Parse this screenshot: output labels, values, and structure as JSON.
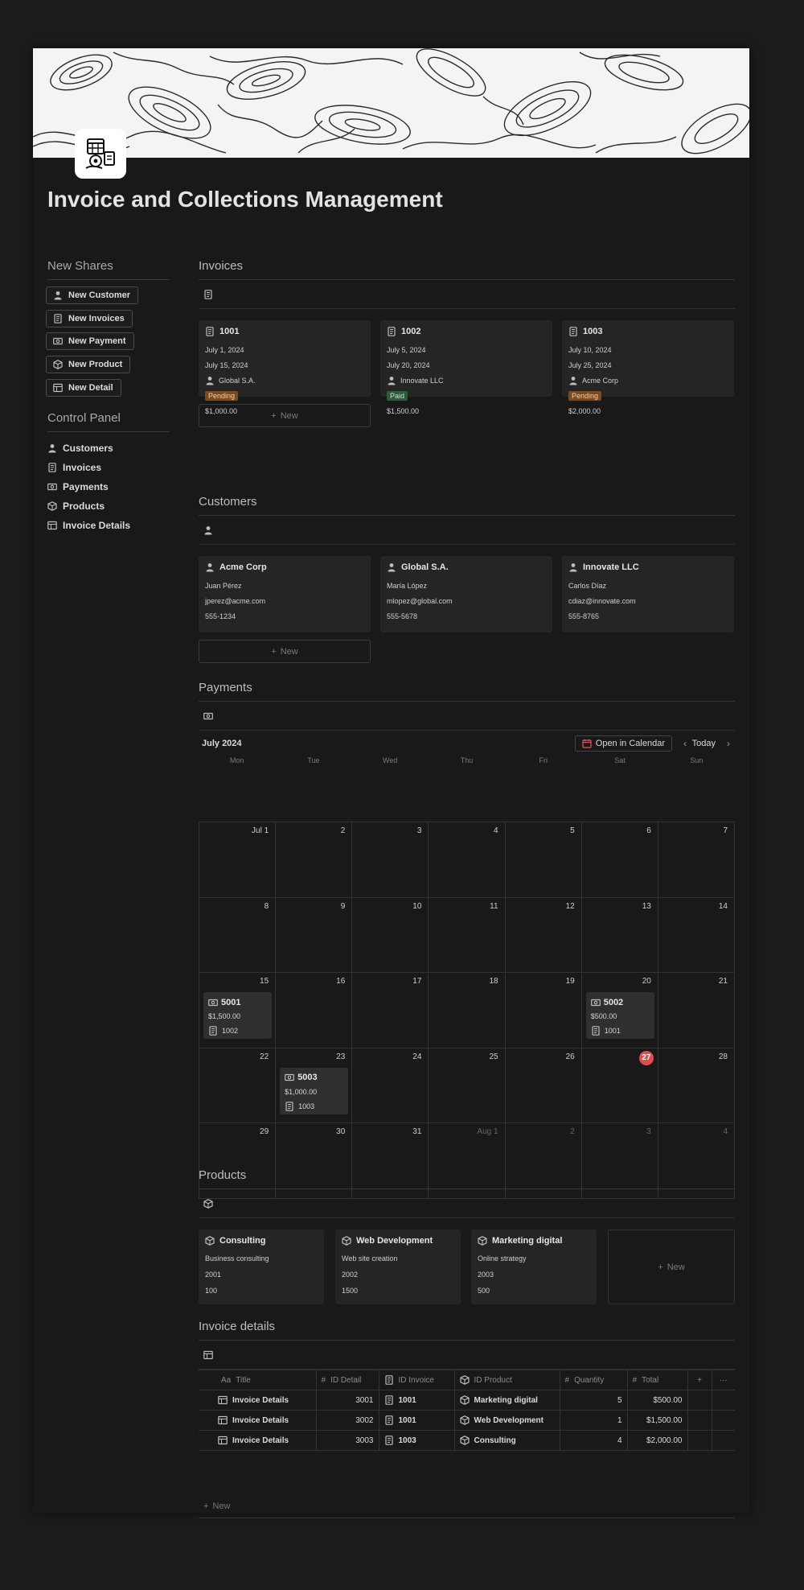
{
  "page": {
    "title": "Invoice and Collections Management"
  },
  "sidebar": {
    "new_shares_heading": "New Shares",
    "buttons": [
      {
        "label": "New Customer",
        "icon": "person-icon"
      },
      {
        "label": "New Invoices",
        "icon": "receipt-icon"
      },
      {
        "label": "New Payment",
        "icon": "money-icon"
      },
      {
        "label": "New Product",
        "icon": "box-icon"
      },
      {
        "label": "New Detail",
        "icon": "table-icon"
      }
    ],
    "control_panel_heading": "Control Panel",
    "links": [
      {
        "label": "Customers",
        "icon": "person-icon"
      },
      {
        "label": "Invoices",
        "icon": "receipt-icon"
      },
      {
        "label": "Payments",
        "icon": "money-icon"
      },
      {
        "label": "Products",
        "icon": "box-icon"
      },
      {
        "label": "Invoice Details",
        "icon": "table-icon"
      }
    ]
  },
  "invoices": {
    "title": "Invoices",
    "new_label": "New",
    "cards": [
      {
        "id": "1001",
        "date1": "July 1, 2024",
        "date2": "July 15, 2024",
        "customer": "Global S.A.",
        "status": "Pending",
        "amount": "$1,000.00"
      },
      {
        "id": "1002",
        "date1": "July 5, 2024",
        "date2": "July 20, 2024",
        "customer": "Innovate LLC",
        "status": "Paid",
        "amount": "$1,500.00"
      },
      {
        "id": "1003",
        "date1": "July 10, 2024",
        "date2": "July 25, 2024",
        "customer": "Acme Corp",
        "status": "Pending",
        "amount": "$2,000.00"
      }
    ],
    "status_colors": {
      "Pending": "#7c4a1c",
      "Paid": "#2c5a3a"
    }
  },
  "customers": {
    "title": "Customers",
    "new_label": "New",
    "cards": [
      {
        "name": "Acme Corp",
        "contact": "Juan Pérez",
        "email": "jperez@acme.com",
        "phone": "555-1234"
      },
      {
        "name": "Global S.A.",
        "contact": "María López",
        "email": "mlopez@global.com",
        "phone": "555-5678"
      },
      {
        "name": "Innovate LLC",
        "contact": "Carlos Díaz",
        "email": "cdiaz@innovate.com",
        "phone": "555-8765"
      }
    ]
  },
  "payments": {
    "title": "Payments",
    "month": "July 2024",
    "open_in_calendar": "Open in Calendar",
    "today": "Today",
    "weekdays": [
      "Mon",
      "Tue",
      "Wed",
      "Thu",
      "Fri",
      "Sat",
      "Sun"
    ],
    "days": [
      "Jul 1",
      "2",
      "3",
      "4",
      "5",
      "6",
      "7",
      "8",
      "9",
      "10",
      "11",
      "12",
      "13",
      "14",
      "15",
      "16",
      "17",
      "18",
      "19",
      "20",
      "21",
      "22",
      "23",
      "24",
      "25",
      "26",
      "27",
      "28",
      "29",
      "30",
      "31",
      "Aug 1",
      "2",
      "3",
      "4"
    ],
    "today_index": 26,
    "today_color": "#e34c4c",
    "events": [
      {
        "day_index": 14,
        "id": "5001",
        "amount": "$1,500.00",
        "invoice": "1002"
      },
      {
        "day_index": 19,
        "id": "5002",
        "amount": "$500.00",
        "invoice": "1001"
      },
      {
        "day_index": 22,
        "id": "5003",
        "amount": "$1,000.00",
        "invoice": "1003"
      }
    ]
  },
  "products": {
    "title": "Products",
    "new_label": "New",
    "cards": [
      {
        "name": "Consulting",
        "description": "Business consulting",
        "code": "2001",
        "price": "100"
      },
      {
        "name": "Web Development",
        "description": "Web site creation",
        "code": "2002",
        "price": "1500"
      },
      {
        "name": "Marketing digital",
        "description": "Online strategy",
        "code": "2003",
        "price": "500"
      }
    ]
  },
  "invoice_details": {
    "title": "Invoice details",
    "new_label": "New",
    "columns": {
      "title": "Title",
      "id_detail": "ID Detail",
      "id_invoice": "ID Invoice",
      "id_product": "ID Product",
      "quantity": "Quantity",
      "total": "Total",
      "add": "+",
      "more": "···"
    },
    "rows": [
      {
        "title": "Invoice Details",
        "id_detail": "3001",
        "id_invoice": "1001",
        "id_product": "Marketing digital",
        "quantity": "5",
        "total": "$500.00"
      },
      {
        "title": "Invoice Details",
        "id_detail": "3002",
        "id_invoice": "1001",
        "id_product": "Web Development",
        "quantity": "1",
        "total": "$1,500.00"
      },
      {
        "title": "Invoice Details",
        "id_detail": "3003",
        "id_invoice": "1003",
        "id_product": "Consulting",
        "quantity": "4",
        "total": "$2,000.00"
      }
    ]
  }
}
